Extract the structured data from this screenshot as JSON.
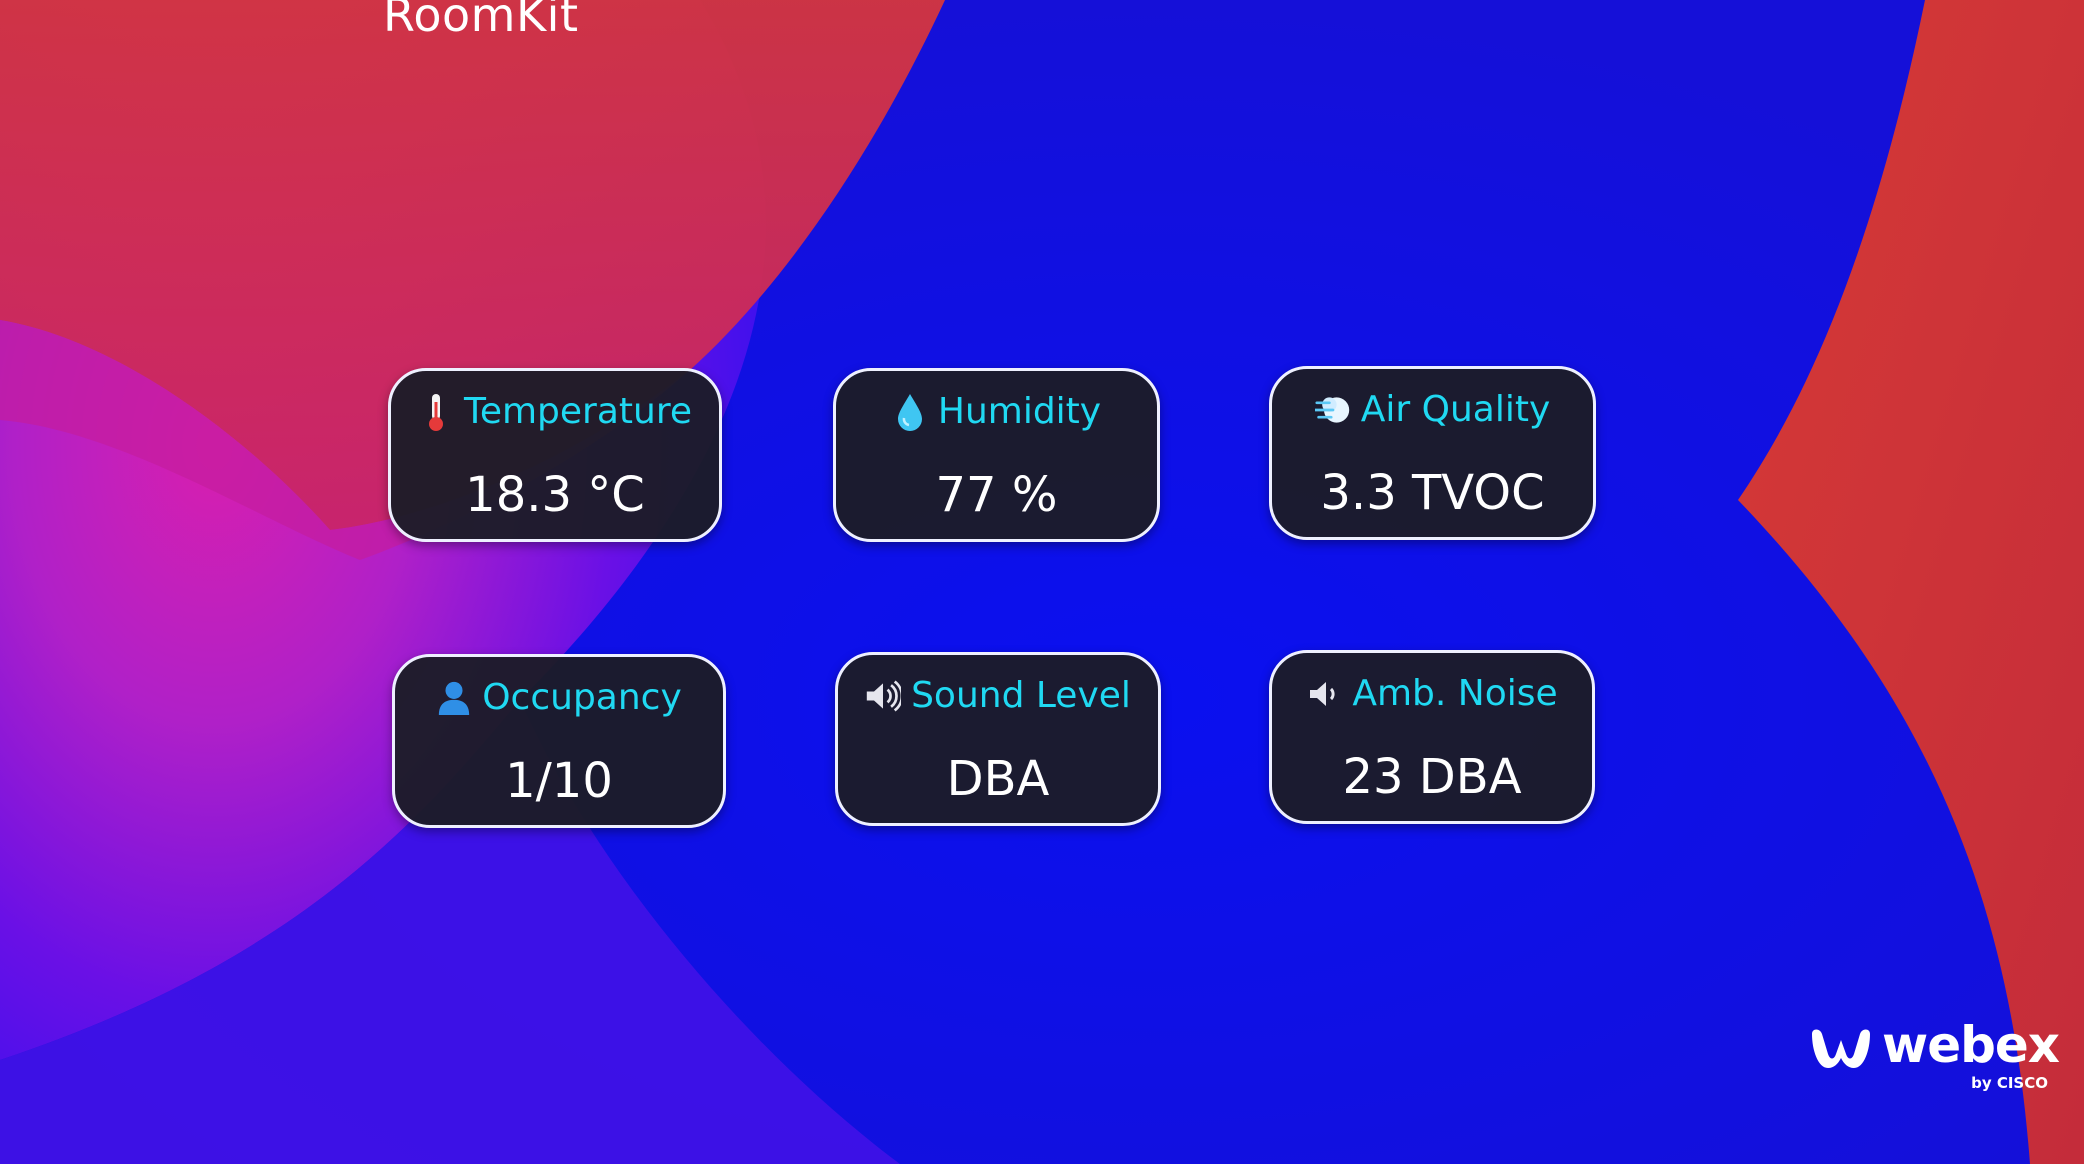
{
  "header": {
    "device_name": "RoomKit"
  },
  "tiles": [
    {
      "id": "temperature",
      "label": "Temperature",
      "value": "18.3 °C",
      "icon": "thermometer-icon"
    },
    {
      "id": "humidity",
      "label": "Humidity",
      "value": "77 %",
      "icon": "droplet-icon"
    },
    {
      "id": "air-quality",
      "label": "Air Quality",
      "value": "3.3 TVOC",
      "icon": "wind-icon"
    },
    {
      "id": "occupancy",
      "label": "Occupancy",
      "value": "1/10",
      "icon": "person-icon"
    },
    {
      "id": "sound-level",
      "label": "Sound Level",
      "value": "DBA",
      "icon": "speaker-icon"
    },
    {
      "id": "ambient-noise",
      "label": "Amb. Noise",
      "value": "23 DBA",
      "icon": "speaker-low-icon"
    }
  ],
  "brand": {
    "name": "webex",
    "sub": "by CISCO"
  },
  "colors": {
    "background_blue": "#0b10e6",
    "background_red": "#d6303c",
    "background_magenta": "#c21fb0",
    "tile_fill": "#1c1c28",
    "tile_border": "#eef0ff",
    "label_cyan": "#20d9f2",
    "value_white": "#ffffff"
  }
}
